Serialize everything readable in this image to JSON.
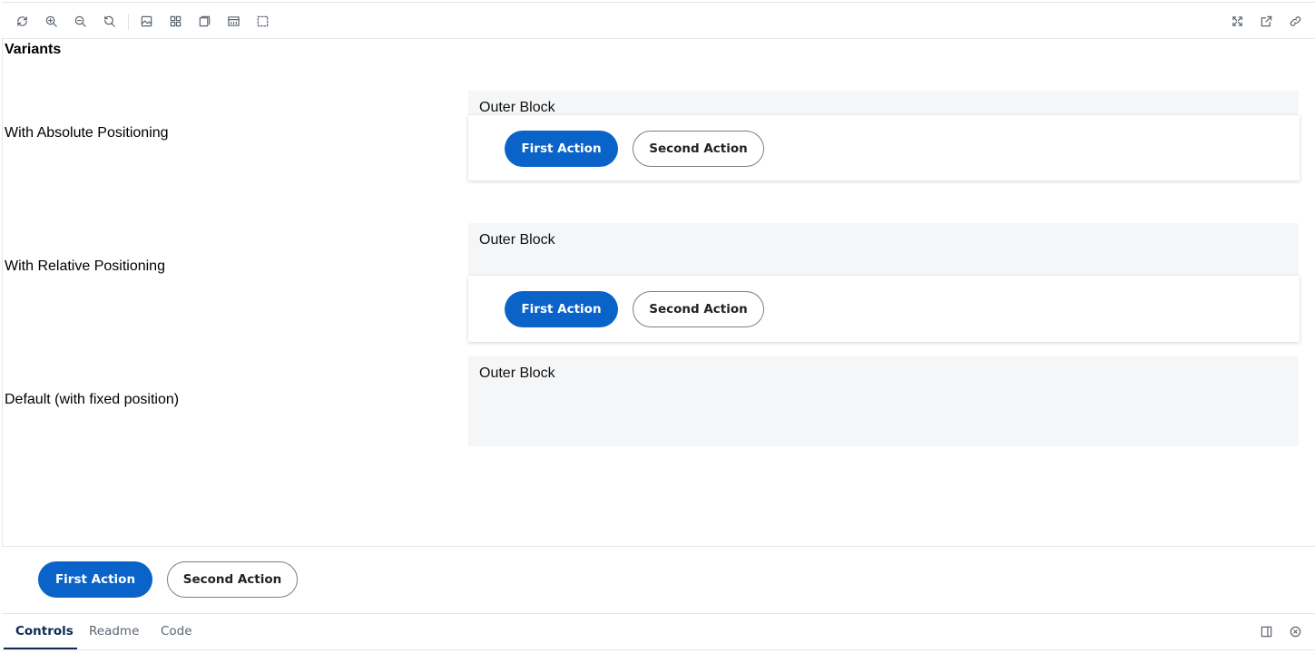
{
  "toolbar": {
    "left_tools": [
      "reload-icon",
      "zoom-in-icon",
      "zoom-out-icon",
      "zoom-reset-icon",
      "background-icon",
      "grid-icon",
      "viewport-icon",
      "measure-icon",
      "outline-icon"
    ],
    "right_tools": [
      "fullscreen-icon",
      "open-new-tab-icon",
      "copy-link-icon"
    ]
  },
  "canvas": {
    "heading": "Variants",
    "rows": [
      {
        "label": "With Absolute Positioning",
        "outer_text": "Outer Block",
        "primary": "First Action",
        "secondary": "Second Action"
      },
      {
        "label": "With Relative Positioning",
        "outer_text": "Outer Block",
        "primary": "First Action",
        "secondary": "Second Action"
      },
      {
        "label": "Default (with fixed position)",
        "outer_text": "Outer Block"
      }
    ]
  },
  "footer": {
    "primary": "First Action",
    "secondary": "Second Action"
  },
  "addons": {
    "tabs": [
      "Controls",
      "Readme",
      "Code"
    ],
    "active_tab": "Controls",
    "right_icons": [
      "panel-toggle-icon",
      "close-icon"
    ]
  },
  "colors": {
    "primary": "#0a63c9",
    "outer_bg": "#f5f6f7",
    "active_tab": "#0b2a55"
  }
}
